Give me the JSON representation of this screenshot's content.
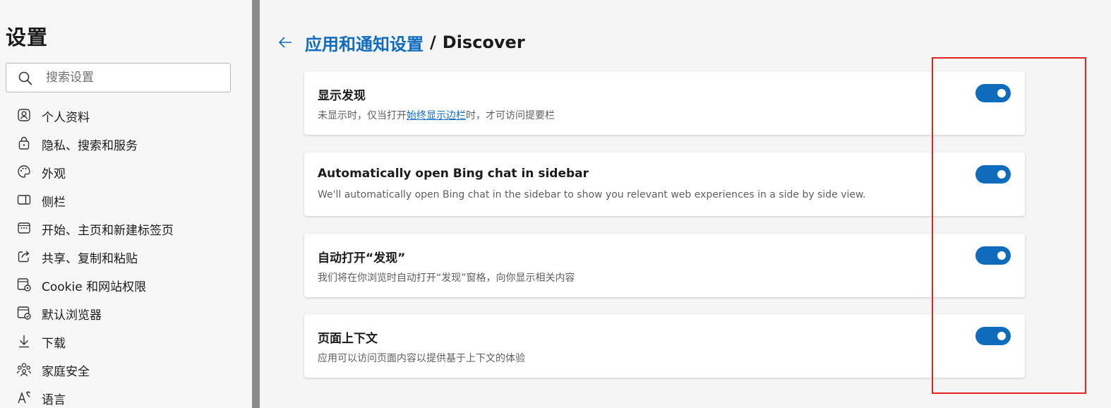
{
  "sidebar": {
    "title": "设置",
    "search": {
      "placeholder": "搜索设置",
      "value": ""
    },
    "items": [
      {
        "label": "个人资料",
        "icon": "profile-icon"
      },
      {
        "label": "隐私、搜索和服务",
        "icon": "lock-icon"
      },
      {
        "label": "外观",
        "icon": "palette-icon"
      },
      {
        "label": "侧栏",
        "icon": "sidebar-icon"
      },
      {
        "label": "开始、主页和新建标签页",
        "icon": "home-tab-icon"
      },
      {
        "label": "共享、复制和粘贴",
        "icon": "share-icon"
      },
      {
        "label": "Cookie 和网站权限",
        "icon": "cookie-icon"
      },
      {
        "label": "默认浏览器",
        "icon": "browser-icon"
      },
      {
        "label": "下载",
        "icon": "download-icon"
      },
      {
        "label": "家庭安全",
        "icon": "family-icon"
      },
      {
        "label": "语言",
        "icon": "language-icon"
      }
    ]
  },
  "header": {
    "breadcrumb_link": "应用和通知设置",
    "separator": "/",
    "current": "Discover"
  },
  "settings": [
    {
      "title": "显示发现",
      "desc_before": "未显示时，仅当打开",
      "desc_link": "始终显示边栏",
      "desc_after": "时，才可访问提要栏",
      "enabled": true
    },
    {
      "title": "Automatically open Bing chat in sidebar",
      "desc": "We'll automatically open Bing chat in the sidebar to show you relevant web experiences in a side by side view.",
      "enabled": true
    },
    {
      "title": "自动打开“发现”",
      "desc": "我们将在你浏览时自动打开“发现”窗格，向你显示相关内容",
      "enabled": true
    },
    {
      "title": "页面上下文",
      "desc": "应用可以访问页面内容以提供基于上下文的体验",
      "enabled": true
    }
  ],
  "colors": {
    "accent": "#0f6cbd",
    "highlight_box": "#e02424"
  }
}
